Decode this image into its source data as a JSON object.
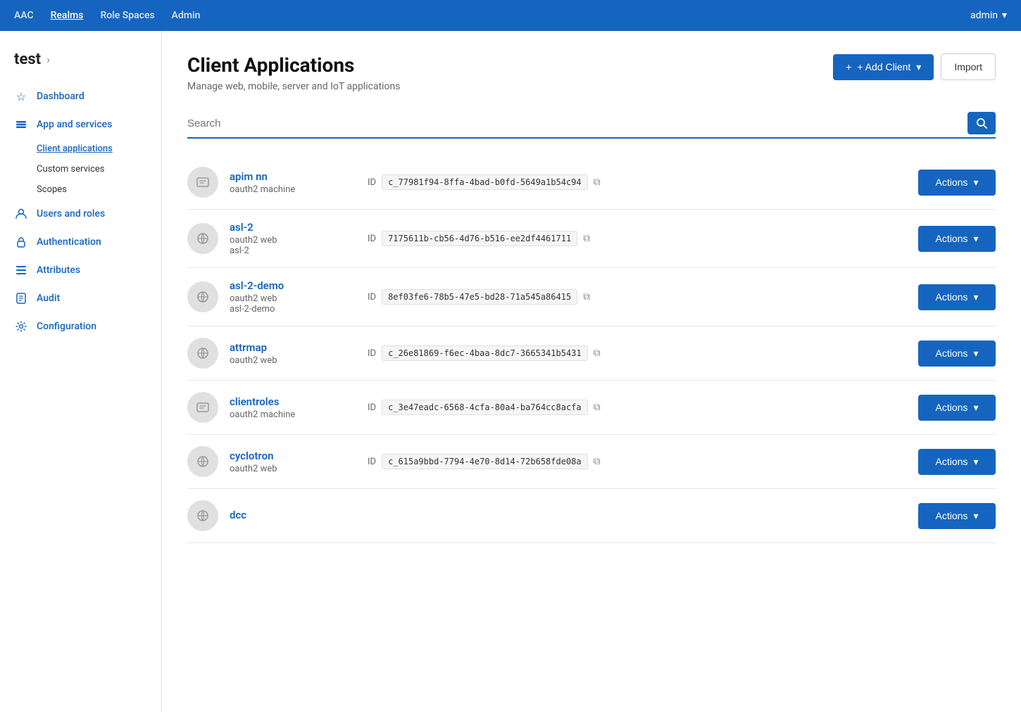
{
  "topnav": {
    "items": [
      {
        "id": "aac",
        "label": "AAC",
        "active": false
      },
      {
        "id": "realms",
        "label": "Realms",
        "active": true
      },
      {
        "id": "role-spaces",
        "label": "Role Spaces",
        "active": false
      },
      {
        "id": "admin",
        "label": "Admin",
        "active": false
      }
    ],
    "user": "admin",
    "chevron": "▾"
  },
  "sidebar": {
    "realm_name": "test",
    "realm_chevron": "›",
    "items": [
      {
        "id": "dashboard",
        "label": "Dashboard",
        "icon": "☆"
      },
      {
        "id": "app-services",
        "label": "App and services",
        "icon": "⊕",
        "subitems": [
          {
            "id": "client-apps",
            "label": "Client applications",
            "active": true
          },
          {
            "id": "custom-services",
            "label": "Custom services",
            "active": false
          },
          {
            "id": "scopes",
            "label": "Scopes",
            "active": false
          }
        ]
      },
      {
        "id": "users-roles",
        "label": "Users and roles",
        "icon": "👤"
      },
      {
        "id": "authentication",
        "label": "Authentication",
        "icon": "🔒"
      },
      {
        "id": "attributes",
        "label": "Attributes",
        "icon": "▤"
      },
      {
        "id": "audit",
        "label": "Audit",
        "icon": "📋"
      },
      {
        "id": "configuration",
        "label": "Configuration",
        "icon": "⚙"
      }
    ]
  },
  "page": {
    "title": "Client Applications",
    "subtitle": "Manage web, mobile, server and IoT applications",
    "add_client_label": "+ Add Client",
    "add_client_chevron": "▾",
    "import_label": "Import"
  },
  "search": {
    "placeholder": "Search",
    "value": ""
  },
  "clients": [
    {
      "id": "apim-nn",
      "name": "apim nn",
      "type": "oauth2 machine",
      "slug": "",
      "icon_type": "machine",
      "client_id": "c_77981f94-8ffa-4bad-b0fd-5649a1b54c94",
      "actions_label": "Actions",
      "actions_chevron": "▾"
    },
    {
      "id": "asl-2",
      "name": "asl-2",
      "type": "oauth2 web",
      "slug": "asl-2",
      "icon_type": "web",
      "client_id": "7175611b-cb56-4d76-b516-ee2df4461711",
      "actions_label": "Actions",
      "actions_chevron": "▾"
    },
    {
      "id": "asl-2-demo",
      "name": "asl-2-demo",
      "type": "oauth2 web",
      "slug": "asl-2-demo",
      "icon_type": "web",
      "client_id": "8ef03fe6-78b5-47e5-bd28-71a545a86415",
      "actions_label": "Actions",
      "actions_chevron": "▾"
    },
    {
      "id": "attrmap",
      "name": "attrmap",
      "type": "oauth2 web",
      "slug": "",
      "icon_type": "web",
      "client_id": "c_26e81869-f6ec-4baa-8dc7-3665341b5431",
      "actions_label": "Actions",
      "actions_chevron": "▾"
    },
    {
      "id": "clientroles",
      "name": "clientroles",
      "type": "oauth2 machine",
      "slug": "",
      "icon_type": "machine",
      "client_id": "c_3e47eadc-6568-4cfa-80a4-ba764cc8acfa",
      "actions_label": "Actions",
      "actions_chevron": "▾"
    },
    {
      "id": "cyclotron",
      "name": "cyclotron",
      "type": "oauth2 web",
      "slug": "",
      "icon_type": "web",
      "client_id": "c_615a9bbd-7794-4e70-8d14-72b658fde08a",
      "actions_label": "Actions",
      "actions_chevron": "▾"
    },
    {
      "id": "dcc",
      "name": "dcc",
      "type": "",
      "slug": "",
      "icon_type": "web",
      "client_id": "",
      "actions_label": "Actions",
      "actions_chevron": "▾"
    }
  ],
  "icons": {
    "machine": "✉",
    "web": "📌",
    "search": "🔍",
    "copy": "⧉",
    "chevron_down": "▾",
    "plus": "+"
  }
}
